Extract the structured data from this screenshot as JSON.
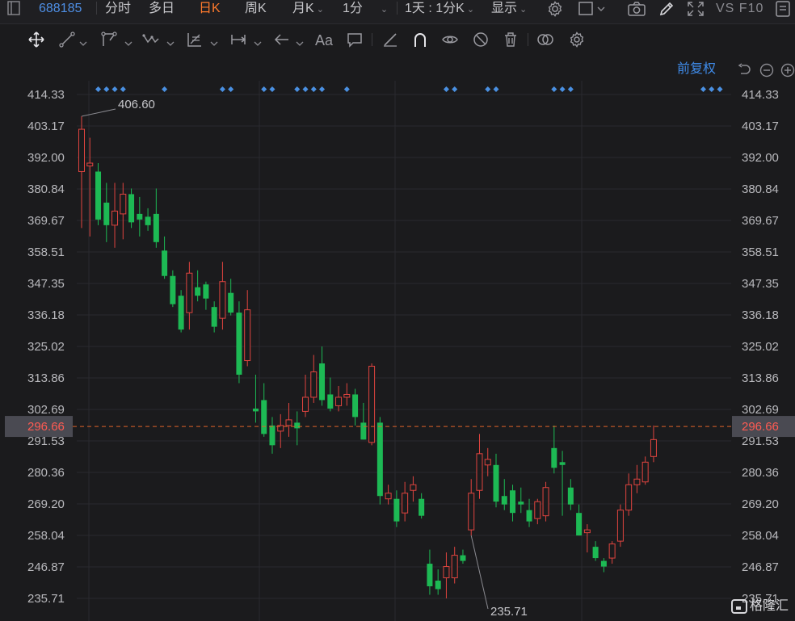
{
  "topbar": {
    "code": "688185",
    "tabs": [
      {
        "label": "分时",
        "active": false
      },
      {
        "label": "多日",
        "active": false
      },
      {
        "label": "日K",
        "active": true
      },
      {
        "label": "周K",
        "active": false
      },
      {
        "label": "月K",
        "active": false,
        "dropdown": true
      },
      {
        "label": "1分",
        "active": false,
        "dropdown": true
      }
    ],
    "period_select": "1天 : 1分K",
    "display_label": "显示",
    "indicator_text": "VS F10"
  },
  "toolbar": {
    "tools": [
      "move-icon",
      "line-icon",
      "polyline-icon",
      "wave-icon",
      "fib-icon",
      "range-icon",
      "arrow-left-icon",
      "text-tool",
      "comment-icon",
      "ruler-icon",
      "magnet-icon",
      "eye-icon",
      "hide-icon",
      "trash-icon",
      "link-icon",
      "settings-icon"
    ],
    "text_tool_label": "Aa"
  },
  "header": {
    "adjust_label": "前复权"
  },
  "watermark": {
    "text": "格隆汇"
  },
  "colors": {
    "up": "#e0443f",
    "down": "#1db954",
    "grid": "#2a2a2e",
    "marker": "#4a90e2",
    "price_line": "#e0622a",
    "current_price_bg": "#4a4a52",
    "background": "#1b1b1d"
  },
  "chart_data": {
    "type": "candlestick",
    "y_ticks": [
      "414.33",
      "403.17",
      "392.00",
      "380.84",
      "369.67",
      "358.51",
      "347.35",
      "336.18",
      "325.02",
      "313.86",
      "302.69",
      "291.53",
      "280.36",
      "269.20",
      "258.04",
      "246.87",
      "235.71"
    ],
    "ylim": [
      235.71,
      414.33
    ],
    "current_price": 296.66,
    "current_price_label": "296.66",
    "max_label": "406.60",
    "min_label": "235.71",
    "max_index": 0,
    "min_index": 47,
    "marker_indices": [
      2,
      3,
      4,
      5,
      10,
      17,
      18,
      22,
      23,
      26,
      27,
      28,
      29,
      32,
      44,
      45,
      49,
      50,
      57,
      58,
      59,
      75,
      76,
      77
    ],
    "candles": [
      {
        "o": 387,
        "h": 406.6,
        "l": 367,
        "c": 402
      },
      {
        "o": 389,
        "h": 399,
        "l": 364,
        "c": 390
      },
      {
        "o": 387,
        "h": 390,
        "l": 368,
        "c": 370
      },
      {
        "o": 376,
        "h": 383,
        "l": 362,
        "c": 368
      },
      {
        "o": 368,
        "h": 383,
        "l": 360,
        "c": 373
      },
      {
        "o": 372,
        "h": 383,
        "l": 363,
        "c": 379
      },
      {
        "o": 379,
        "h": 381,
        "l": 367,
        "c": 369
      },
      {
        "o": 372,
        "h": 378,
        "l": 364,
        "c": 370
      },
      {
        "o": 371,
        "h": 374,
        "l": 366,
        "c": 368
      },
      {
        "o": 372,
        "h": 381,
        "l": 360,
        "c": 362
      },
      {
        "o": 359,
        "h": 364,
        "l": 349,
        "c": 350
      },
      {
        "o": 350,
        "h": 352,
        "l": 339,
        "c": 340
      },
      {
        "o": 343,
        "h": 345,
        "l": 330,
        "c": 331
      },
      {
        "o": 337,
        "h": 355,
        "l": 331,
        "c": 351
      },
      {
        "o": 346,
        "h": 352,
        "l": 341,
        "c": 343
      },
      {
        "o": 347,
        "h": 348,
        "l": 338,
        "c": 342
      },
      {
        "o": 339,
        "h": 341,
        "l": 330,
        "c": 332
      },
      {
        "o": 335,
        "h": 355,
        "l": 331,
        "c": 348
      },
      {
        "o": 344,
        "h": 349,
        "l": 336,
        "c": 337
      },
      {
        "o": 337,
        "h": 341,
        "l": 312,
        "c": 315
      },
      {
        "o": 320,
        "h": 345,
        "l": 318,
        "c": 338
      },
      {
        "o": 303,
        "h": 315,
        "l": 298,
        "c": 302
      },
      {
        "o": 306,
        "h": 312,
        "l": 293,
        "c": 294
      },
      {
        "o": 297,
        "h": 300,
        "l": 287,
        "c": 290
      },
      {
        "o": 295,
        "h": 301,
        "l": 289,
        "c": 297
      },
      {
        "o": 297,
        "h": 305,
        "l": 293,
        "c": 299
      },
      {
        "o": 298,
        "h": 302,
        "l": 290,
        "c": 296
      },
      {
        "o": 302,
        "h": 315,
        "l": 300,
        "c": 307
      },
      {
        "o": 307,
        "h": 322,
        "l": 305,
        "c": 316
      },
      {
        "o": 319,
        "h": 325,
        "l": 304,
        "c": 306
      },
      {
        "o": 308,
        "h": 314,
        "l": 302,
        "c": 303
      },
      {
        "o": 304,
        "h": 311,
        "l": 302,
        "c": 307
      },
      {
        "o": 307,
        "h": 312,
        "l": 304,
        "c": 308
      },
      {
        "o": 308,
        "h": 310,
        "l": 297,
        "c": 300
      },
      {
        "o": 298,
        "h": 305,
        "l": 292,
        "c": 292
      },
      {
        "o": 291,
        "h": 319,
        "l": 290,
        "c": 318
      },
      {
        "o": 298,
        "h": 300,
        "l": 269,
        "c": 272
      },
      {
        "o": 271,
        "h": 276,
        "l": 269,
        "c": 273
      },
      {
        "o": 271,
        "h": 274,
        "l": 261,
        "c": 263
      },
      {
        "o": 266,
        "h": 277,
        "l": 263,
        "c": 273
      },
      {
        "o": 274,
        "h": 279,
        "l": 270,
        "c": 276
      },
      {
        "o": 271,
        "h": 273,
        "l": 264,
        "c": 265
      },
      {
        "o": 248,
        "h": 253,
        "l": 237,
        "c": 240
      },
      {
        "o": 242,
        "h": 246,
        "l": 237,
        "c": 239
      },
      {
        "o": 243,
        "h": 252,
        "l": 235.71,
        "c": 247
      },
      {
        "o": 243,
        "h": 254,
        "l": 241,
        "c": 251
      },
      {
        "o": 251,
        "h": 253,
        "l": 248,
        "c": 249
      },
      {
        "o": 260,
        "h": 278,
        "l": 258,
        "c": 273
      },
      {
        "o": 274,
        "h": 294,
        "l": 271,
        "c": 287
      },
      {
        "o": 283,
        "h": 289,
        "l": 279,
        "c": 285
      },
      {
        "o": 283,
        "h": 287,
        "l": 268,
        "c": 270
      },
      {
        "o": 272,
        "h": 278,
        "l": 267,
        "c": 269
      },
      {
        "o": 274,
        "h": 276,
        "l": 263,
        "c": 266
      },
      {
        "o": 270,
        "h": 275,
        "l": 266,
        "c": 269
      },
      {
        "o": 267,
        "h": 271,
        "l": 261,
        "c": 263
      },
      {
        "o": 264,
        "h": 271,
        "l": 262,
        "c": 270
      },
      {
        "o": 265,
        "h": 277,
        "l": 263,
        "c": 275
      },
      {
        "o": 289,
        "h": 297,
        "l": 280,
        "c": 282
      },
      {
        "o": 284,
        "h": 288,
        "l": 265,
        "c": 283
      },
      {
        "o": 275,
        "h": 278,
        "l": 267,
        "c": 269
      },
      {
        "o": 266,
        "h": 269,
        "l": 258,
        "c": 258
      },
      {
        "o": 259,
        "h": 262,
        "l": 252,
        "c": 260
      },
      {
        "o": 254,
        "h": 256,
        "l": 249,
        "c": 250
      },
      {
        "o": 249,
        "h": 250,
        "l": 245,
        "c": 247
      },
      {
        "o": 250,
        "h": 256,
        "l": 248,
        "c": 255
      },
      {
        "o": 256,
        "h": 269,
        "l": 254,
        "c": 267
      },
      {
        "o": 267,
        "h": 280,
        "l": 265,
        "c": 276
      },
      {
        "o": 276,
        "h": 283,
        "l": 273,
        "c": 278
      },
      {
        "o": 277,
        "h": 286,
        "l": 276,
        "c": 284
      },
      {
        "o": 286,
        "h": 297,
        "l": 284,
        "c": 292
      }
    ]
  }
}
